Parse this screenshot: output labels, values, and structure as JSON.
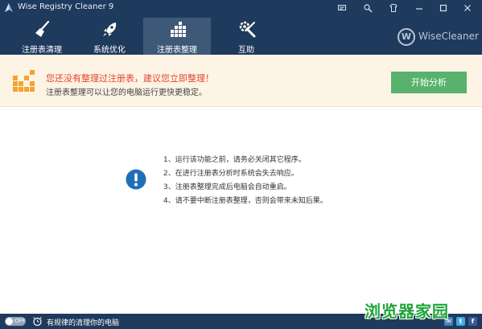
{
  "app": {
    "title": "Wise Registry Cleaner 9"
  },
  "window_controls": [
    "feedback-icon",
    "settings-icon",
    "skin-icon",
    "minimize-icon",
    "maximize-icon",
    "close-icon"
  ],
  "tabs": [
    {
      "label": "注册表清理",
      "icon": "broom-icon",
      "active": false
    },
    {
      "label": "系统优化",
      "icon": "rocket-icon",
      "active": false
    },
    {
      "label": "注册表整理",
      "icon": "blocks-icon",
      "active": true
    },
    {
      "label": "互助",
      "icon": "tools-icon",
      "active": false
    }
  ],
  "brand": {
    "badge": "W",
    "name": "WiseCleaner"
  },
  "notice": {
    "title": "您还没有整理过注册表，建议您立即整理！",
    "subtitle": "注册表整理可以让您的电脑运行更快更稳定。",
    "button_label": "开始分析"
  },
  "instructions": [
    "1、运行该功能之前，请务必关闭其它程序。",
    "2、在进行注册表分析时系统会失去响应。",
    "3、注册表整理完成后电脑会自动重启。",
    "4、请不要中断注册表整理，否则会带来未知后果。"
  ],
  "statusbar": {
    "toggle_label": "OFF",
    "schedule_text": "有规律的清理你的电脑",
    "social": [
      "mail-icon",
      "twitter-icon",
      "facebook-icon"
    ]
  },
  "watermark": "浏览器家园",
  "colors": {
    "titlebar": "#1e3a5c",
    "active_tab": "#3e5878",
    "notice_bg": "#fdf4e5",
    "notice_title": "#e0462c",
    "start_button": "#58b26b",
    "info_icon": "#1f6fb5"
  }
}
